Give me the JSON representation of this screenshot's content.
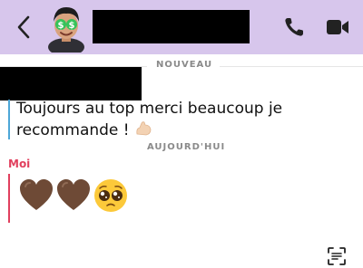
{
  "header": {
    "contact_name": "",
    "avatar_alt": "bitmoji-avatar"
  },
  "dividers": {
    "new_label": "NOUVEAU",
    "today_label": "AUJOURD'HUI"
  },
  "messages": [
    {
      "sender": "",
      "text": "Toujours au top merci beaucoup je recommande ! ",
      "trailing_emoji": "flexed-biceps"
    },
    {
      "sender": "Moi",
      "emojis": [
        "brown-heart",
        "brown-heart",
        "pleading-face"
      ]
    }
  ],
  "colors": {
    "header_bg": "#d7c6ec",
    "incoming_bar": "#4ea7d8",
    "outgoing_bar": "#e1405e",
    "heart": "#6e4a36"
  }
}
